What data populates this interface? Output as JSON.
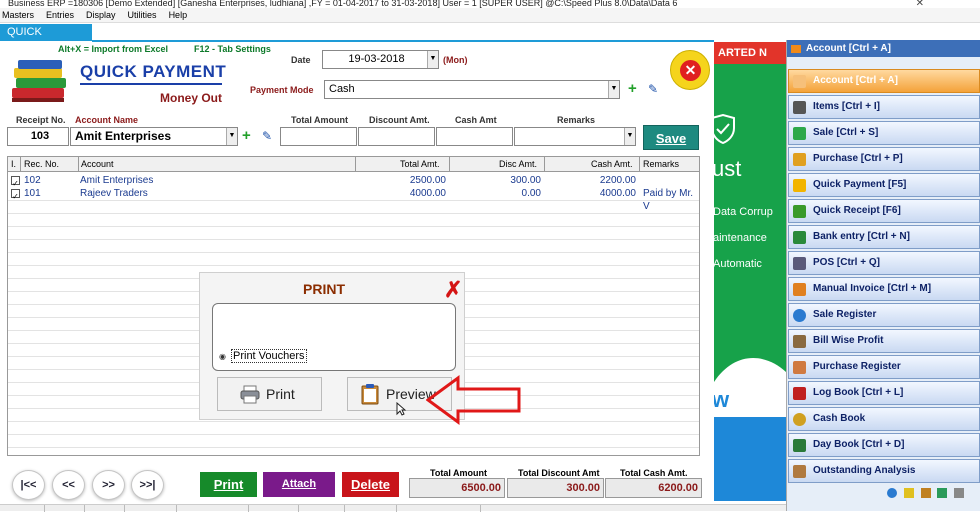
{
  "window": {
    "title": "Business ERP =180306  [Demo Extended]  [Ganesha Enterprises, ludhiana] ,FY = 01-04-2017 to 31-03-2018] User = 1 [SUPER USER] @C:\\Speed Plus 8.0\\Data\\Data 6"
  },
  "menubar": [
    "Masters",
    "Entries",
    "Display",
    "Utilities",
    "Help"
  ],
  "form_tab": "QUICK PAYMENT",
  "hints": {
    "import": "Alt+X =  Import from Excel",
    "settings": "F12 - Tab Settings"
  },
  "header": {
    "title": "QUICK PAYMENT",
    "subtitle": "Money Out"
  },
  "date": {
    "label": "Date",
    "value": "19-03-2018",
    "day": "(Mon)"
  },
  "payment_mode": {
    "label": "Payment Mode",
    "value": "Cash"
  },
  "entry": {
    "receipt_no_label": "Receipt No.",
    "receipt_no": "103",
    "account_name_label": "Account Name",
    "account_name": "Amit Enterprises",
    "total_amount_label": "Total Amount",
    "discount_amt_label": "Discount Amt.",
    "cash_amt_label": "Cash Amt",
    "remarks_label": "Remarks"
  },
  "save_button": {
    "label": "Save"
  },
  "grid": {
    "headers": [
      "I.",
      "Rec. No.",
      "Account",
      "Total Amt.",
      "Disc Amt.",
      "Cash Amt.",
      "Remarks"
    ],
    "rows": [
      {
        "rec_no": "102",
        "account": "Amit Enterprises",
        "total": "2500.00",
        "disc": "300.00",
        "cash": "2200.00",
        "remarks": ""
      },
      {
        "rec_no": "101",
        "account": "Rajeev Traders",
        "total": "4000.00",
        "disc": "0.00",
        "cash": "4000.00",
        "remarks": "Paid by Mr. V"
      }
    ]
  },
  "print_dialog": {
    "title": "PRINT",
    "option": "Print Vouchers",
    "print_label": "Print",
    "preview_label": "Preview"
  },
  "nav": [
    "|<<",
    "<<",
    ">>",
    ">>|"
  ],
  "actions": {
    "print": "Print",
    "attach": "Attach",
    "delete": "Delete"
  },
  "totals": {
    "total_amount_label": "Total Amount",
    "total_amount": "6500.00",
    "total_discount_label": "Total Discount Amt",
    "total_discount": "300.00",
    "total_cash_label": "Total Cash Amt.",
    "total_cash": "6200.00"
  },
  "banner": {
    "header": "ARTED N",
    "line1": "ust",
    "line2": "Data Corrup",
    "line3": "aintenance",
    "line4": "Automatic",
    "w": "w"
  },
  "side_menu": {
    "header": "Account [Ctrl + A]",
    "items": [
      {
        "label": "Account [Ctrl + A]",
        "icon": "account-icon",
        "color": "#f08a1a"
      },
      {
        "label": "Items [Ctrl + I]",
        "icon": "items-icon",
        "color": "#555555"
      },
      {
        "label": "Sale [Ctrl + S]",
        "icon": "sale-icon",
        "color": "#2ea84a"
      },
      {
        "label": "Purchase [Ctrl + P]",
        "icon": "purchase-icon",
        "color": "#e0a020"
      },
      {
        "label": "Quick Payment [F5]",
        "icon": "quick-payment-icon",
        "color": "#f2b400"
      },
      {
        "label": "Quick Receipt [F6]",
        "icon": "quick-receipt-icon",
        "color": "#3a9a2a"
      },
      {
        "label": "Bank entry [Ctrl + N]",
        "icon": "bank-icon",
        "color": "#2a8a3a"
      },
      {
        "label": "POS [Ctrl + Q]",
        "icon": "pos-icon",
        "color": "#5a5a7a"
      },
      {
        "label": "Manual Invoice [Ctrl + M]",
        "icon": "invoice-icon",
        "color": "#e08020"
      },
      {
        "label": "Sale Register",
        "icon": "sale-register-icon",
        "color": "#2a7ad0"
      },
      {
        "label": "Bill Wise Profit",
        "icon": "profit-icon",
        "color": "#8a6a40"
      },
      {
        "label": "Purchase Register",
        "icon": "purchase-register-icon",
        "color": "#d07a40"
      },
      {
        "label": "Log Book [Ctrl + L]",
        "icon": "log-book-icon",
        "color": "#c02020"
      },
      {
        "label": "Cash Book",
        "icon": "cash-book-icon",
        "color": "#d0a020"
      },
      {
        "label": "Day Book [Ctrl + D]",
        "icon": "day-book-icon",
        "color": "#2a7a3a"
      },
      {
        "label": "Outstanding Analysis",
        "icon": "outstanding-icon",
        "color": "#b07a40"
      }
    ]
  }
}
